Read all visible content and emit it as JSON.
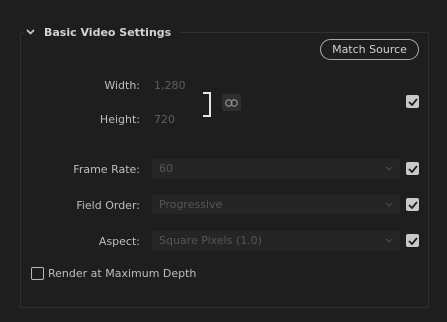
{
  "section": {
    "title": "Basic Video Settings",
    "match_source_label": "Match Source"
  },
  "dimensions": {
    "width_label": "Width:",
    "width_value": "1,280",
    "height_label": "Height:",
    "height_value": "720"
  },
  "frame_rate": {
    "label": "Frame Rate:",
    "value": "60"
  },
  "field_order": {
    "label": "Field Order:",
    "value": "Progressive"
  },
  "aspect": {
    "label": "Aspect:",
    "value": "Square Pixels (1.0)"
  },
  "render_max_depth": {
    "label": "Render at Maximum Depth",
    "checked": false
  },
  "icons": {
    "expand": "chevron-down-icon",
    "link": "link-icon",
    "check": "checkmark-icon",
    "dropdown": "chevron-down-icon"
  }
}
